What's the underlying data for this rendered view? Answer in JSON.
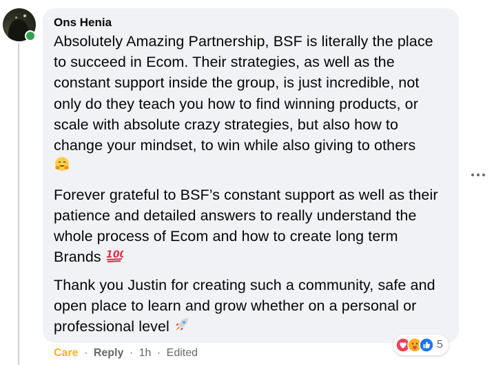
{
  "comment": {
    "author": "Ons Henia",
    "paragraphs": [
      "Absolutely Amazing Partnership, BSF is literally the place to succeed in Ecom. Their strategies, as well as the constant support inside the group, is just incredible, not only do they teach you how to find winning products, or scale with absolute crazy strategies, but also how to change your mindset, to win while also giving to others",
      "Forever grateful to BSF’s constant support as well as their patience and detailed answers to really understand the whole process of Ecom and how to create long term Brands",
      "Thank you Justin for creating such a community, safe and open place to learn and grow whether on a personal or professional level"
    ],
    "paragraph_emojis": [
      "hugging-face",
      "hundred-points",
      "rocket"
    ]
  },
  "actions": {
    "care_label": "Care",
    "separator": "·",
    "reply_label": "Reply",
    "timestamp": "1h",
    "edited_label": "Edited"
  },
  "reactions": {
    "count": "5",
    "icons": [
      "love-reaction-icon",
      "care-reaction-icon",
      "like-reaction-icon"
    ]
  },
  "colors": {
    "bubble": "#f0f2f5",
    "care": "#f7b125",
    "secondary_text": "#65676b",
    "online": "#31a24c",
    "like": "#1877f2",
    "love": "#f33e58"
  }
}
